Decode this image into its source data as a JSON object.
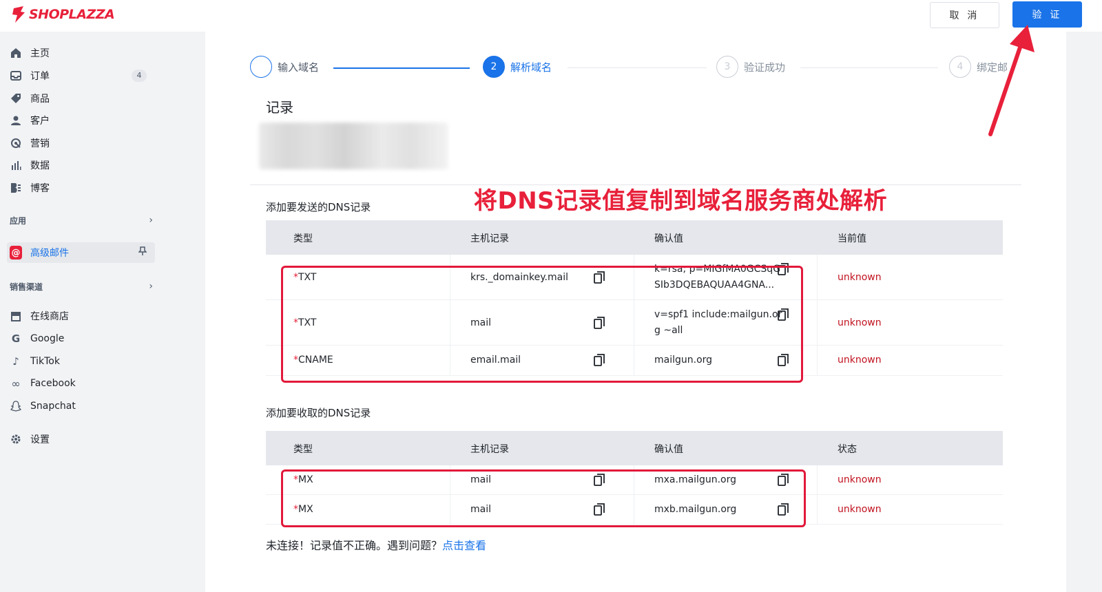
{
  "brand": {
    "name": "SHOPLAZZA",
    "color": "#e8203a"
  },
  "header": {
    "cancel_label": "取 消",
    "verify_label": "验 证"
  },
  "sidebar": {
    "items": [
      {
        "label": "主页",
        "icon": "home-icon"
      },
      {
        "label": "订单",
        "icon": "inbox-icon",
        "badge": "4"
      },
      {
        "label": "商品",
        "icon": "tag-icon"
      },
      {
        "label": "客户",
        "icon": "user-icon"
      },
      {
        "label": "营销",
        "icon": "marketing-icon"
      },
      {
        "label": "数据",
        "icon": "bar-chart-icon"
      },
      {
        "label": "博客",
        "icon": "blog-icon"
      }
    ],
    "apps_section": "应用",
    "active_app": {
      "label": "高级邮件",
      "icon_char": "@"
    },
    "sales_section": "销售渠道",
    "channels": [
      {
        "label": "在线商店",
        "icon": "store-icon"
      },
      {
        "label": "Google",
        "icon": "google-icon"
      },
      {
        "label": "TikTok",
        "icon": "tiktok-icon"
      },
      {
        "label": "Facebook",
        "icon": "meta-icon"
      },
      {
        "label": "Snapchat",
        "icon": "snapchat-icon"
      }
    ],
    "settings": {
      "label": "设置",
      "icon": "gear-icon"
    }
  },
  "steps": [
    {
      "number": "",
      "label": "输入域名",
      "state": "done"
    },
    {
      "number": "2",
      "label": "解析域名",
      "state": "active"
    },
    {
      "number": "3",
      "label": "验证成功",
      "state": "pending"
    },
    {
      "number": "4",
      "label": "绑定邮",
      "state": "pending"
    }
  ],
  "record_title": "记录",
  "annotation": "将DNS记录值复制到域名服务商处解析",
  "send_section": {
    "title": "添加要发送的DNS记录",
    "headers": [
      "类型",
      "主机记录",
      "确认值",
      "当前值"
    ],
    "rows": [
      {
        "type": "TXT",
        "host": "krs._domainkey.mail",
        "value_line1": "k=rsa; p=MIGfMA0GCSqG",
        "value_line2": "SIb3DQEBAQUAA4GNA...",
        "current": "unknown"
      },
      {
        "type": "TXT",
        "host": "mail",
        "value_line1": "v=spf1 include:mailgun.or",
        "value_line2": "g ~all",
        "current": "unknown"
      },
      {
        "type": "CNAME",
        "host": "email.mail",
        "value_line1": "mailgun.org",
        "value_line2": "",
        "current": "unknown"
      }
    ]
  },
  "receive_section": {
    "title": "添加要收取的DNS记录",
    "headers": [
      "类型",
      "主机记录",
      "确认值",
      "状态"
    ],
    "rows": [
      {
        "type": "MX",
        "host": "mail",
        "value": "mxa.mailgun.org",
        "status": "unknown"
      },
      {
        "type": "MX",
        "host": "mail",
        "value": "mxb.mailgun.org",
        "status": "unknown"
      }
    ]
  },
  "footer": {
    "text": "未连接！记录值不正确。遇到问题？",
    "link": "点击查看"
  },
  "colors": {
    "accent": "#1a73e8",
    "annotation": "#e8203a",
    "status_unknown": "#c1121f"
  }
}
